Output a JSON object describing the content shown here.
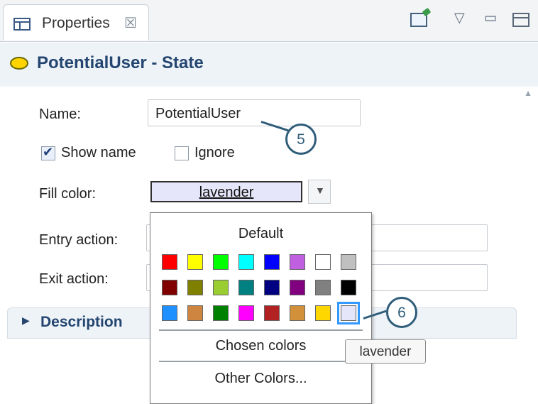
{
  "tab": {
    "title": "Properties",
    "close": "☒"
  },
  "toolbar": {
    "menu_glyph": "▽",
    "min_glyph": "▭"
  },
  "header": {
    "title": "PotentialUser - State"
  },
  "form": {
    "name_label": "Name:",
    "name_value": "PotentialUser",
    "show_name_label": "Show name",
    "show_name_checked": true,
    "ignore_label": "Ignore",
    "ignore_checked": false,
    "fill_label": "Fill color:",
    "fill_value": "lavender",
    "entry_label": "Entry action:",
    "exit_label": "Exit action:"
  },
  "description": {
    "label": "Description",
    "arrow": "▶"
  },
  "popup": {
    "default_label": "Default",
    "rows": [
      [
        "#ff0000",
        "#ffff00",
        "#00ff00",
        "#00ffff",
        "#0000ff",
        "#c060e0",
        "#ffffff",
        "#c0c0c0"
      ],
      [
        "#800000",
        "#808000",
        "#9acd32",
        "#008080",
        "#000080",
        "#800080",
        "#808080",
        "#000000"
      ],
      [
        "#1e90ff",
        "#cd853f",
        "#008000",
        "#ff00ff",
        "#b22222",
        "#d2903a",
        "#ffd700",
        "#e6e6fa"
      ]
    ],
    "selected": "lavender",
    "chosen_label": "Chosen colors",
    "other_label": "Other Colors..."
  },
  "tooltip": {
    "text": "lavender"
  },
  "callouts": [
    "5",
    "6"
  ]
}
